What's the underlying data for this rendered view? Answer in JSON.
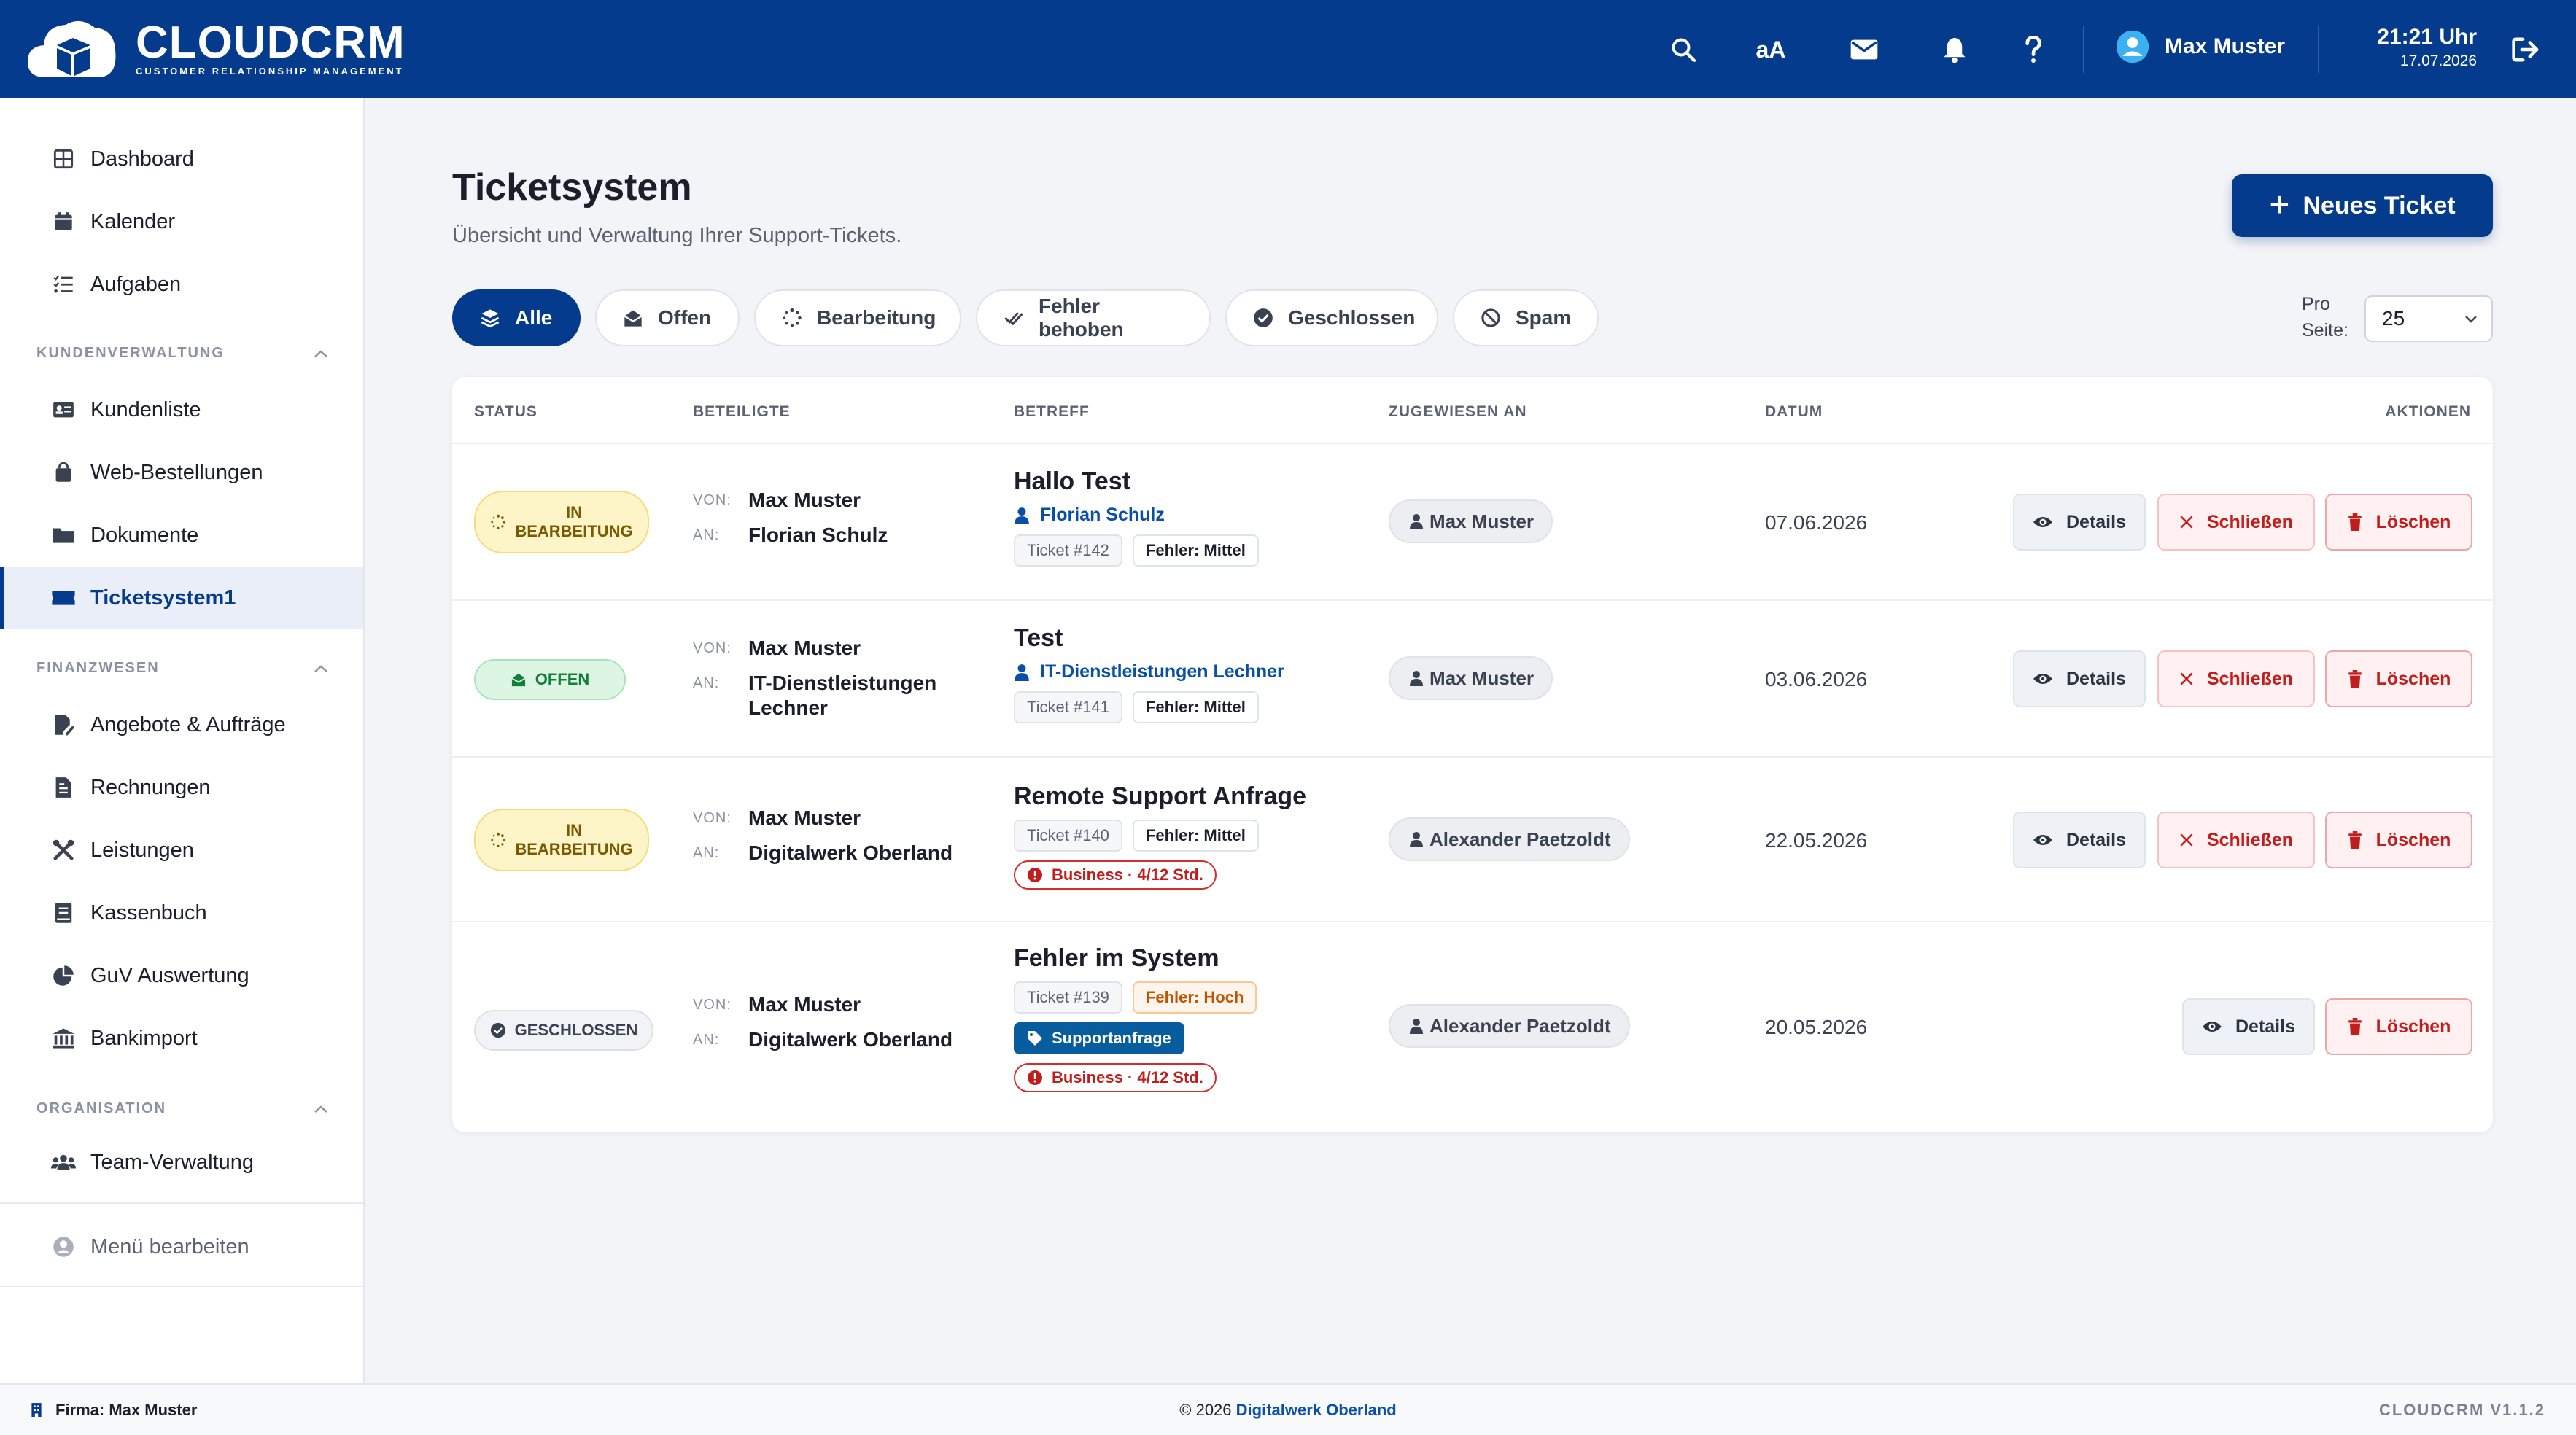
{
  "app": {
    "logo_main": "CLOUDCRM",
    "logo_sub": "CUSTOMER RELATIONSHIP MANAGEMENT",
    "brand_color": "#043b8c"
  },
  "topbar": {
    "user_name": "Max Muster",
    "font_size_label": "aA",
    "time": "21:21 Uhr",
    "date": "17.07.2026"
  },
  "sidebar": {
    "top_items": [
      {
        "label": "Dashboard",
        "icon": "dashboard-icon"
      },
      {
        "label": "Kalender",
        "icon": "calendar-icon"
      },
      {
        "label": "Aufgaben",
        "icon": "tasks-icon"
      }
    ],
    "sections": [
      {
        "title": "KUNDENVERWALTUNG",
        "items": [
          {
            "label": "Kundenliste",
            "icon": "id-card-icon"
          },
          {
            "label": "Web-Bestellungen",
            "icon": "shopping-bag-icon"
          },
          {
            "label": "Dokumente",
            "icon": "folder-icon"
          },
          {
            "label": "Ticketsystem1",
            "icon": "ticket-icon",
            "active": true
          }
        ]
      },
      {
        "title": "FINANZWESEN",
        "items": [
          {
            "label": "Angebote & Aufträge",
            "icon": "file-signature-icon"
          },
          {
            "label": "Rechnungen",
            "icon": "invoice-icon"
          },
          {
            "label": "Leistungen",
            "icon": "tools-icon"
          },
          {
            "label": "Kassenbuch",
            "icon": "book-icon"
          },
          {
            "label": "GuV Auswertung",
            "icon": "pie-chart-icon"
          },
          {
            "label": "Bankimport",
            "icon": "bank-icon"
          }
        ]
      },
      {
        "title": "ORGANISATION",
        "items": [
          {
            "label": "Team-Verwaltung",
            "icon": "team-icon"
          }
        ]
      }
    ],
    "edit_menu_label": "Menü bearbeiten"
  },
  "main": {
    "title": "Ticketsystem",
    "subtitle": "Übersicht und Verwaltung Ihrer Support-Tickets.",
    "new_ticket_label": "Neues Ticket",
    "filters": [
      {
        "label": "Alle",
        "icon": "layers-icon",
        "active": true
      },
      {
        "label": "Offen",
        "icon": "envelope-open-icon"
      },
      {
        "label": "Bearbeitung",
        "icon": "spinner-icon"
      },
      {
        "label": "Fehler behoben",
        "icon": "check-double-icon"
      },
      {
        "label": "Geschlossen",
        "icon": "check-circle-icon"
      },
      {
        "label": "Spam",
        "icon": "ban-icon"
      }
    ],
    "per_page_label_1": "Pro",
    "per_page_label_2": "Seite:",
    "per_page_value": "25",
    "columns": {
      "status": "STATUS",
      "participants": "BETEILIGTE",
      "subject": "BETREFF",
      "assigned": "ZUGEWIESEN AN",
      "date": "DATUM",
      "actions": "AKTIONEN"
    },
    "from_label": "VON:",
    "to_label": "AN:",
    "actions": {
      "details": "Details",
      "close": "Schließen",
      "delete": "Löschen"
    },
    "tickets": [
      {
        "status_line1": "IN",
        "status_line2": "BEARBEITUNG",
        "from": "Max Muster",
        "to": "Florian Schulz",
        "subject": "Hallo Test",
        "contact": "Florian Schulz",
        "ticket_no": "Ticket #142",
        "error_level": "Fehler: Mittel",
        "assignee": "Max Muster",
        "date": "07.06.2026"
      },
      {
        "status": "OFFEN",
        "from": "Max Muster",
        "to_line1": "IT-Dienstleistungen",
        "to_line2": "Lechner",
        "subject": "Test",
        "contact": "IT-Dienstleistungen Lechner",
        "ticket_no": "Ticket #141",
        "error_level": "Fehler: Mittel",
        "assignee": "Max Muster",
        "date": "03.06.2026"
      },
      {
        "status_line1": "IN",
        "status_line2": "BEARBEITUNG",
        "from": "Max Muster",
        "to": "Digitalwerk Oberland",
        "subject": "Remote Support Anfrage",
        "ticket_no": "Ticket #140",
        "error_level": "Fehler: Mittel",
        "sla": "Business · 4/12 Std.",
        "assignee": "Alexander Paetzoldt",
        "date": "22.05.2026"
      },
      {
        "status": "GESCHLOSSEN",
        "from": "Max Muster",
        "to": "Digitalwerk Oberland",
        "subject": "Fehler im System",
        "ticket_no": "Ticket #139",
        "error_level": "Fehler: Hoch",
        "tag": "Supportanfrage",
        "sla": "Business · 4/12 Std.",
        "assignee": "Alexander Paetzoldt",
        "date": "20.05.2026"
      }
    ]
  },
  "footer": {
    "company": "Firma: Max Muster",
    "copyright": "© 2026",
    "copyright_company": "Digitalwerk Oberland",
    "version": "CLOUDCRM V1.1.2"
  }
}
